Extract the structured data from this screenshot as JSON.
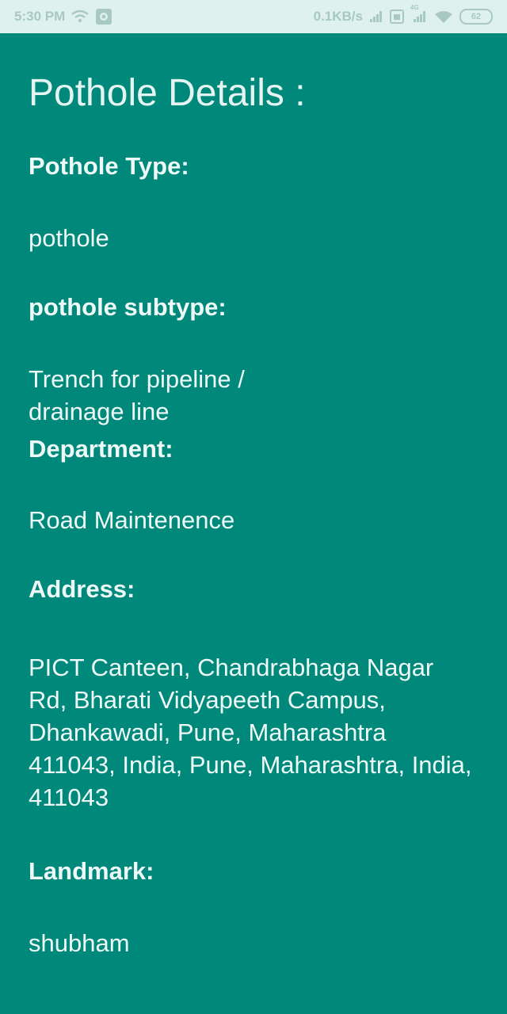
{
  "status_bar": {
    "time": "5:30 PM",
    "network_speed": "0.1KB/s",
    "battery_level": "62",
    "network_type": "4G",
    "icons": [
      "wifi-icon",
      "app-notification-icon",
      "signal-icon",
      "sim-icon",
      "signal-icon",
      "wifi-icon",
      "battery-icon"
    ]
  },
  "page": {
    "title": "Pothole Details :"
  },
  "details": {
    "pothole_type_label": "Pothole Type:",
    "pothole_type_value": "pothole",
    "pothole_subtype_label": "pothole subtype:",
    "pothole_subtype_value": "Trench for pipeline / drainage line",
    "department_label": "Department:",
    "department_value": "Road Maintenence",
    "address_label": "Address:",
    "address_value": "PICT Canteen, Chandrabhaga Nagar Rd, Bharati Vidyapeeth Campus, Dhankawadi, Pune, Maharashtra 411043, India, Pune, Maharashtra, India, 411043",
    "landmark_label": "Landmark:",
    "landmark_value": "shubham"
  },
  "colors": {
    "background": "#00897b",
    "status_bar": "#dff1ee",
    "text": "#eef9f7"
  }
}
